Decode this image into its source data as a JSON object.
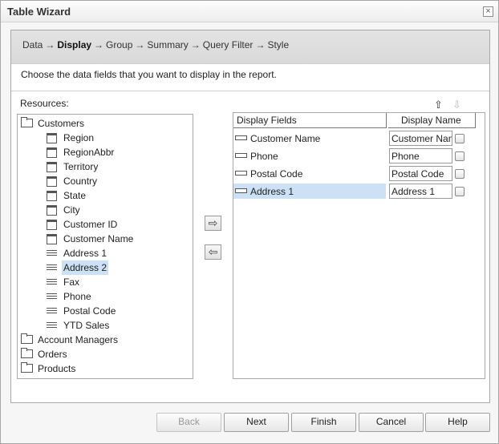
{
  "window": {
    "title": "Table Wizard",
    "close_glyph": "×"
  },
  "steps": [
    {
      "label": "Data",
      "active": false
    },
    {
      "label": "Display",
      "active": true
    },
    {
      "label": "Group",
      "active": false
    },
    {
      "label": "Summary",
      "active": false
    },
    {
      "label": "Query Filter",
      "active": false
    },
    {
      "label": "Style",
      "active": false
    }
  ],
  "step_arrow": "→",
  "instruction": "Choose the data fields that you want to display in the report.",
  "resources": {
    "label": "Resources:",
    "tree": {
      "root": "Customers",
      "fields": [
        {
          "label": "Region",
          "icon": "field-icon"
        },
        {
          "label": "RegionAbbr",
          "icon": "field-icon"
        },
        {
          "label": "Territory",
          "icon": "field-icon"
        },
        {
          "label": "Country",
          "icon": "field-icon"
        },
        {
          "label": "State",
          "icon": "field-icon"
        },
        {
          "label": "City",
          "icon": "field-icon"
        },
        {
          "label": "Customer ID",
          "icon": "field-icon"
        },
        {
          "label": "Customer Name",
          "icon": "field-icon"
        },
        {
          "label": "Address 1",
          "icon": "lines-icon"
        },
        {
          "label": "Address 2",
          "icon": "lines-icon",
          "selected": true
        },
        {
          "label": "Fax",
          "icon": "lines-icon"
        },
        {
          "label": "Phone",
          "icon": "lines-icon"
        },
        {
          "label": "Postal Code",
          "icon": "lines-icon"
        },
        {
          "label": "YTD Sales",
          "icon": "lines-icon"
        }
      ],
      "folders": [
        "Account Managers",
        "Orders",
        "Products"
      ]
    }
  },
  "move": {
    "add_glyph": "⇨",
    "remove_glyph": "⇦"
  },
  "order": {
    "up_glyph": "⇧",
    "down_glyph": "⇩"
  },
  "display": {
    "header_fields": "Display Fields",
    "header_name": "Display Name",
    "rows": [
      {
        "field": "Customer Name",
        "name": "Customer Nam",
        "selected": false
      },
      {
        "field": "Phone",
        "name": "Phone",
        "selected": false
      },
      {
        "field": "Postal Code",
        "name": "Postal Code",
        "selected": false
      },
      {
        "field": "Address 1",
        "name": "Address 1",
        "selected": true
      }
    ]
  },
  "buttons": {
    "back": "Back",
    "next": "Next",
    "finish": "Finish",
    "cancel": "Cancel",
    "help": "Help"
  },
  "colors": {
    "selection": "#cce1f6"
  }
}
